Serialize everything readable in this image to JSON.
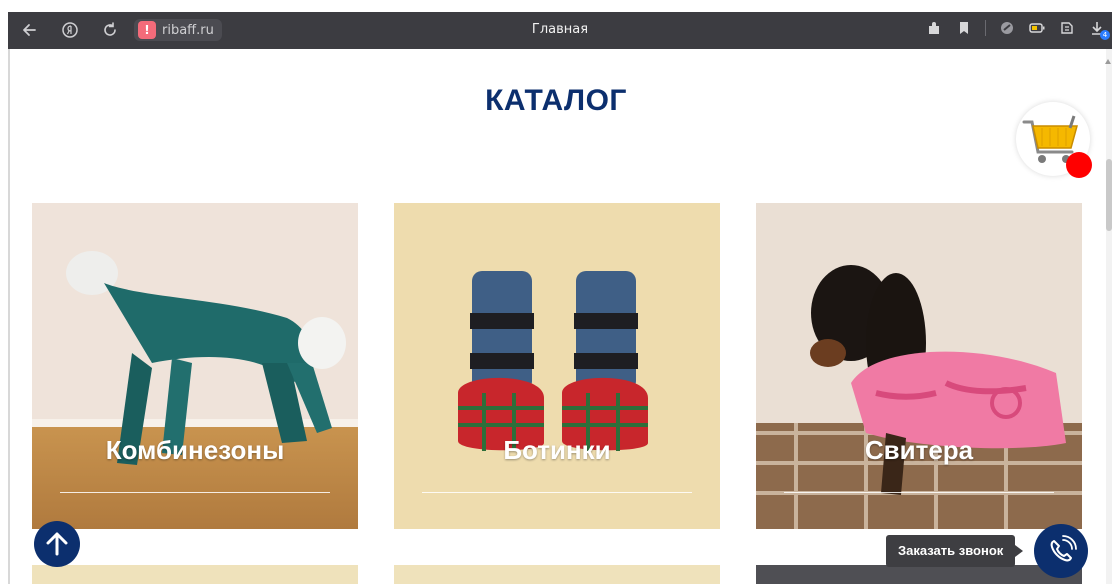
{
  "browser": {
    "address": "ribaff.ru",
    "tab_title": "Главная",
    "download_count": "4",
    "icons": [
      "back-arrow-icon",
      "yandex-icon",
      "reload-icon",
      "warning-icon",
      "extension-icon",
      "bookmark-icon",
      "vpn-icon",
      "battery-icon",
      "reader-icon",
      "download-icon"
    ]
  },
  "page": {
    "heading": "КАТАЛОГ",
    "cards": [
      {
        "title": "Комбинезоны"
      },
      {
        "title": "Ботинки"
      },
      {
        "title": "Свитера"
      }
    ],
    "callback_label": "Заказать звонок"
  },
  "colors": {
    "brand_blue": "#0c2f6e",
    "chrome_bg": "#3c3c41",
    "cart_dot": "#ff0000",
    "tooltip_bg": "#3e3e42"
  }
}
